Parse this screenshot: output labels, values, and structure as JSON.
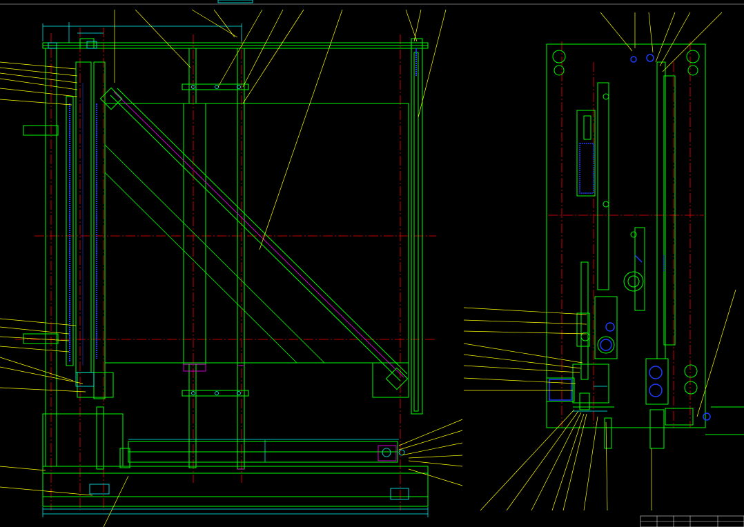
{
  "drawing": {
    "sheet_title": "",
    "views": [
      "front-view",
      "side-view"
    ]
  },
  "title_block": {
    "cells": [
      "",
      "",
      "",
      "",
      "",
      ""
    ]
  },
  "colors": {
    "background": "#000000",
    "outline": "#00ff00",
    "center_line": "#ff0000",
    "leader": "#ffff00",
    "dimension": "#00ffff",
    "hidden": "#0000ff",
    "accent": "#ff00ff",
    "text": "#ffffff"
  }
}
